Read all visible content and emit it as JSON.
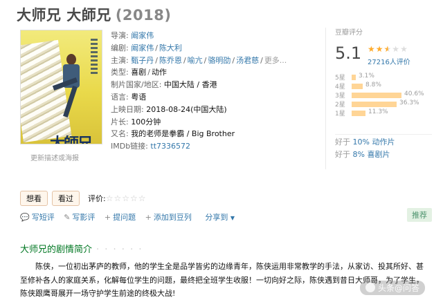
{
  "title": {
    "name": "大师兄 大師兄",
    "year": "(2018)"
  },
  "poster": {
    "title_text": "大師兄",
    "caption": "更新描述或海报"
  },
  "info": {
    "director": {
      "label": "导演:",
      "values": [
        "阚家伟"
      ]
    },
    "writer": {
      "label": "编剧:",
      "values": [
        "阚家伟",
        "陈大利"
      ]
    },
    "cast": {
      "label": "主演:",
      "values": [
        "甄子丹",
        "陈乔恩",
        "喻亢",
        "骆明劭",
        "汤君慈"
      ],
      "more": "更多..."
    },
    "genre": {
      "label": "类型:",
      "values": [
        "喜剧",
        "动作"
      ]
    },
    "country": {
      "label": "制片国家/地区:",
      "value": "中国大陆 / 香港"
    },
    "language": {
      "label": "语言:",
      "value": "粤语"
    },
    "release": {
      "label": "上映日期:",
      "value": "2018-08-24(中国大陆)"
    },
    "runtime": {
      "label": "片长:",
      "value": "100分钟"
    },
    "aka": {
      "label": "又名:",
      "value": "我的老师是拳霸 / Big Brother"
    },
    "imdb": {
      "label": "IMDb链接:",
      "value": "tt7336572"
    }
  },
  "rating": {
    "label": "豆瓣评分",
    "score": "5.1",
    "stars": 2.5,
    "count": "27216人评价",
    "distribution": [
      {
        "label": "5星",
        "pct": "3.1%",
        "value": 3.1
      },
      {
        "label": "4星",
        "pct": "8.8%",
        "value": 8.8
      },
      {
        "label": "3星",
        "pct": "40.6%",
        "value": 40.6
      },
      {
        "label": "2星",
        "pct": "36.3%",
        "value": 36.3
      },
      {
        "label": "1星",
        "pct": "11.3%",
        "value": 11.3
      }
    ],
    "better_than": [
      {
        "prefix": "好于 ",
        "link": "10% 动作片"
      },
      {
        "prefix": "好于 ",
        "link": "8% 喜剧片"
      }
    ]
  },
  "actions": {
    "want": "想看",
    "watched": "看过",
    "rate_label": "评价:",
    "empty_stars": "☆☆☆☆☆"
  },
  "links": {
    "short_review": "写短评",
    "review": "写影评",
    "question": "提问题",
    "add_list": "添加到豆列",
    "share": "分享到",
    "recommend": "推荐"
  },
  "synopsis": {
    "title": "大师兄的剧情简介",
    "dots": "· · · · · ·",
    "body": "陈侠，一位初出茅庐的教师，他的学生全是品学皆劣的边缘青年，陈侠运用非常教学的手法，从家访、投其所好、甚至修补各人的家庭关系，化解每位学生的问题，最终把全班学生收服！一切向好之际，陈侠遇到昔日大师哥，为了学生，陈侠跟鹰哥展开一场守护学生前途的终极大战!"
  },
  "watermark": "头条@问答",
  "colors": {
    "link": "#3377aa",
    "star": "#ffac2d",
    "bar": "#ffd596",
    "synopsis_title": "#007722"
  }
}
